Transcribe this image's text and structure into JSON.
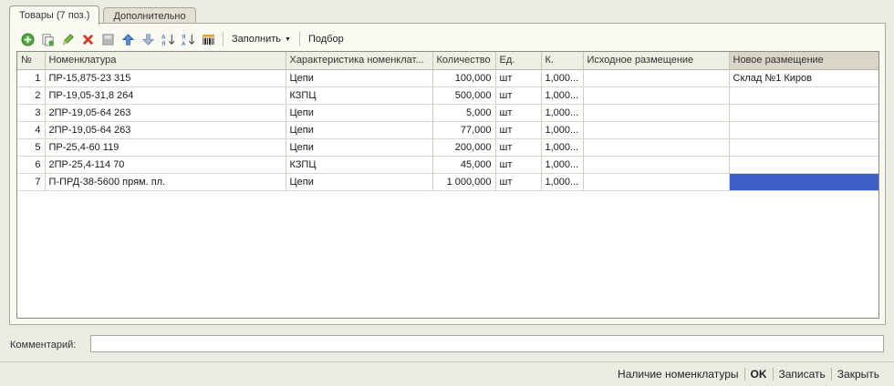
{
  "tabs": [
    {
      "label": "Товары (7 поз.)",
      "active": true
    },
    {
      "label": "Дополнительно",
      "active": false
    }
  ],
  "toolbar": {
    "fill_label": "Заполнить",
    "pick_label": "Подбор",
    "icons": [
      "add-icon",
      "copy-icon",
      "edit-icon",
      "delete-icon",
      "save-icon",
      "move-up-icon",
      "move-down-icon",
      "sort-asc-icon",
      "sort-desc-icon",
      "barcode-icon"
    ]
  },
  "table": {
    "columns": [
      "№",
      "Номенклатура",
      "Характеристика номенклат...",
      "Количество",
      "Ед.",
      "К.",
      "Исходное размещение",
      "Новое размещение"
    ],
    "rows": [
      {
        "n": "1",
        "item": "ПР-15,875-23 315",
        "char": "Цепи",
        "qty": "100,000",
        "unit": "шт",
        "k": "1,000...",
        "src": "",
        "dst": "Склад №1 Киров"
      },
      {
        "n": "2",
        "item": "ПР-19,05-31,8 264",
        "char": "КЗПЦ",
        "qty": "500,000",
        "unit": "шт",
        "k": "1,000...",
        "src": "",
        "dst": ""
      },
      {
        "n": "3",
        "item": "2ПР-19,05-64 263",
        "char": "Цепи",
        "qty": "5,000",
        "unit": "шт",
        "k": "1,000...",
        "src": "",
        "dst": ""
      },
      {
        "n": "4",
        "item": "2ПР-19,05-64 263",
        "char": "Цепи",
        "qty": "77,000",
        "unit": "шт",
        "k": "1,000...",
        "src": "",
        "dst": ""
      },
      {
        "n": "5",
        "item": "ПР-25,4-60 119",
        "char": "Цепи",
        "qty": "200,000",
        "unit": "шт",
        "k": "1,000...",
        "src": "",
        "dst": ""
      },
      {
        "n": "6",
        "item": "2ПР-25,4-114 70",
        "char": "КЗПЦ",
        "qty": "45,000",
        "unit": "шт",
        "k": "1,000...",
        "src": "",
        "dst": ""
      },
      {
        "n": "7",
        "item": "П-ПРД-38-5600 прям. пл.",
        "char": "Цепи",
        "qty": "1 000,000",
        "unit": "шт",
        "k": "1,000...",
        "src": "",
        "dst": ""
      }
    ]
  },
  "comment": {
    "label": "Комментарий:",
    "value": ""
  },
  "footer": {
    "availability": "Наличие номенклатуры",
    "ok": "OK",
    "save": "Записать",
    "close": "Закрыть"
  },
  "colors": {
    "selection": "#3f5fc7",
    "panel": "#fbfaf2",
    "background": "#ecebe3"
  }
}
